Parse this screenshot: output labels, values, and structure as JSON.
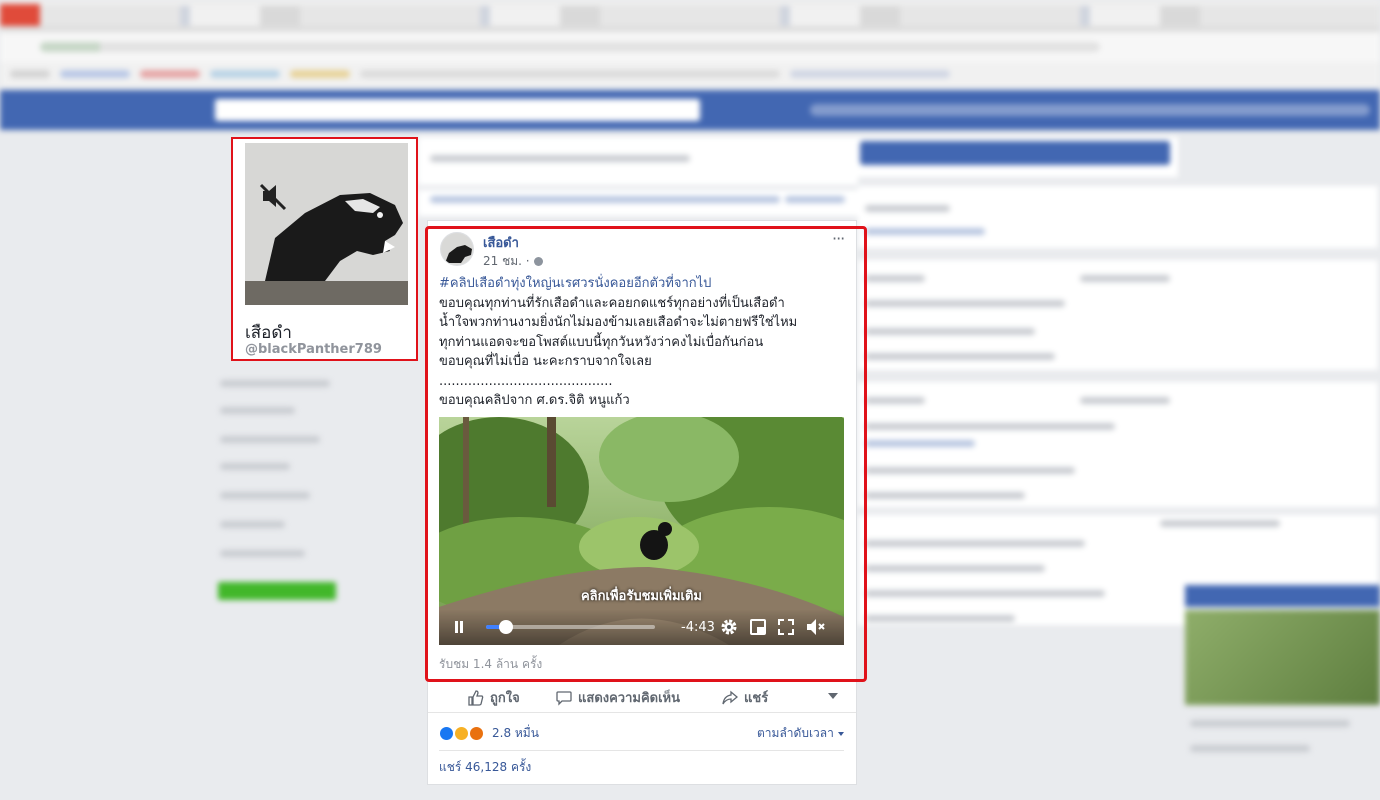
{
  "profile": {
    "name": "เสือดำ",
    "handle": "@blackPanther789",
    "photo_icon": "muted-speaker-icon"
  },
  "post": {
    "author": "เสือดำ",
    "time": "21 ชม. ·",
    "more_label": "···",
    "hashtag": "#คลิปเสือดำทุ่งใหญ่นเรศวรนั่งคอยอีกตัวที่จากไป",
    "lines": [
      "ขอบคุณทุกท่านที่รักเสือดำและคอยกดแชร์ทุกอย่างที่เป็นเสือดำ",
      "น้ำใจพวกท่านงามยิ่งนักไม่มองข้ามเลยเสือดำจะไม่ตายฟรีใช่ไหม",
      "ทุกท่านแอดจะขอโพสต์แบบนี้ทุกวันหวังว่าคงไม่เบื่อกันก่อน",
      "ขอบคุณที่ไม่เบื่อ นะคะกราบจากใจเลย"
    ],
    "divider": "..........................................",
    "credit": "ขอบคุณคลิปจาก ศ.ดร.จิติ หนูแก้ว"
  },
  "video": {
    "caption": "คลิกเพื่อรับชมเพิ่มเติม",
    "time_remaining": "-4:43",
    "progress": 0.12,
    "views": "รับชม 1.4 ล้าน ครั้ง"
  },
  "actions": {
    "like": "ถูกใจ",
    "comment": "แสดงความคิดเห็น",
    "share": "แชร์"
  },
  "reactions": {
    "count": "2.8 หมื่น",
    "colors": [
      "#1877f2",
      "#f7b125",
      "#e9710f"
    ]
  },
  "sort_label": "ตามลำดับเวลา",
  "shares": "แชร์ 46,128 ครั้ง"
}
